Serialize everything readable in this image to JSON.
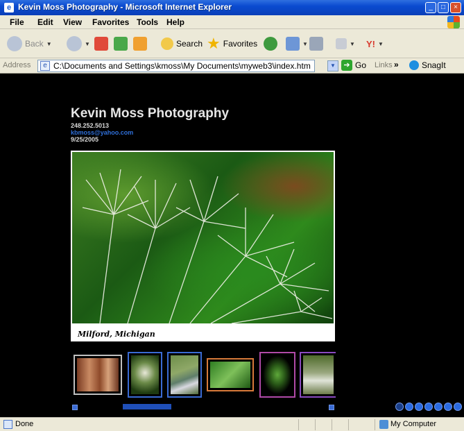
{
  "window": {
    "title": "Kevin Moss Photography - Microsoft Internet Explorer"
  },
  "menu": [
    "File",
    "Edit",
    "View",
    "Favorites",
    "Tools",
    "Help"
  ],
  "toolbar": {
    "back_label": "Back",
    "search_label": "Search",
    "favorites_label": "Favorites"
  },
  "address": {
    "label": "Address",
    "value": "C:\\Documents and Settings\\kmoss\\My Documents\\myweb3\\index.htm",
    "go_label": "Go",
    "links_label": "Links",
    "links_chevron": "»",
    "snagit_label": "SnagIt"
  },
  "page": {
    "title": "Kevin Moss Photography",
    "phone": "248.252.5013",
    "email": "kbmoss@yahoo.com",
    "date": "9/25/2005",
    "caption": "Milford, Michigan"
  },
  "status": {
    "text": "Done",
    "zone": "My Computer"
  },
  "colors": {
    "accent": "#2f6fd8",
    "title_bar": "#0a4bd0",
    "chrome": "#ece9d8"
  }
}
